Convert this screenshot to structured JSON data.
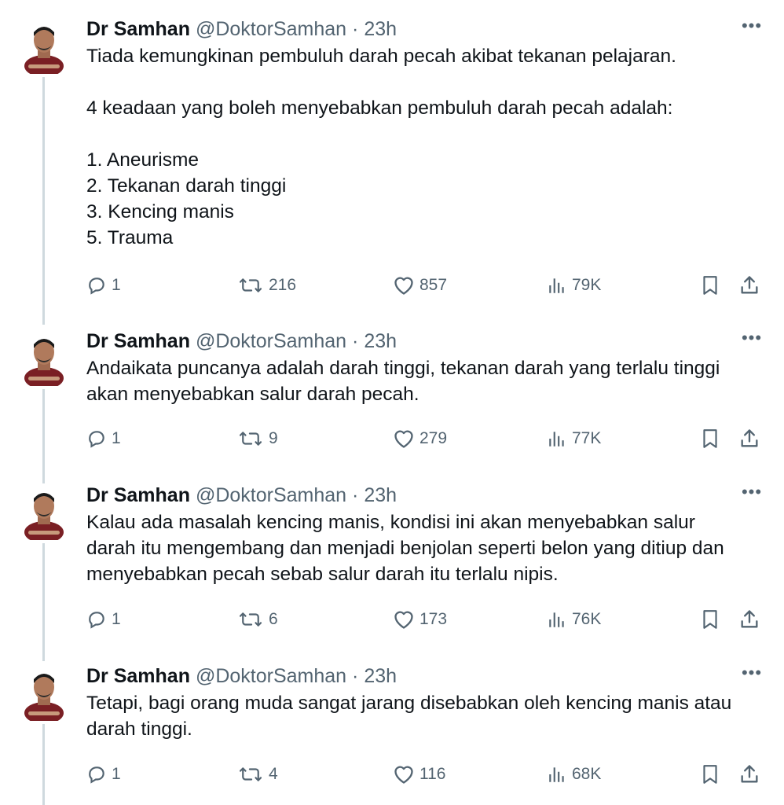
{
  "author": {
    "name": "Dr Samhan",
    "handle": "@DoktorSamhan",
    "separator": "·"
  },
  "tweets": [
    {
      "time": "23h",
      "text": "Tiada kemungkinan pembuluh darah pecah akibat tekanan pelajaran.\n\n4 keadaan yang boleh menyebabkan pembuluh darah pecah adalah:\n\n1. Aneurisme\n2. Tekanan darah tinggi\n3. Kencing manis\n5. Trauma",
      "replies": "1",
      "reposts": "216",
      "likes": "857",
      "views": "79K"
    },
    {
      "time": "23h",
      "text": "Andaikata puncanya adalah darah tinggi, tekanan darah yang terlalu tinggi\nakan menyebabkan salur darah pecah.",
      "replies": "1",
      "reposts": "9",
      "likes": "279",
      "views": "77K"
    },
    {
      "time": "23h",
      "text": "Kalau ada masalah kencing manis, kondisi ini akan menyebabkan salur\ndarah itu mengembang dan menjadi benjolan seperti belon yang ditiup dan\nmenyebabkan pecah sebab salur darah itu terlalu nipis.",
      "replies": "1",
      "reposts": "6",
      "likes": "173",
      "views": "76K"
    },
    {
      "time": "23h",
      "text": "Tetapi, bagi orang muda sangat jarang disebabkan oleh kencing manis atau\ndarah tinggi.",
      "replies": "1",
      "reposts": "4",
      "likes": "116",
      "views": "68K"
    }
  ],
  "icons": {
    "more": "more-icon",
    "reply": "reply-icon",
    "repost": "repost-icon",
    "like": "like-icon",
    "views": "views-icon",
    "bookmark": "bookmark-icon",
    "share": "share-icon"
  },
  "colors": {
    "text": "#0f1419",
    "secondary": "#536471",
    "thread_line": "#cfd9de",
    "avatar_shirt": "#7a1f24"
  }
}
